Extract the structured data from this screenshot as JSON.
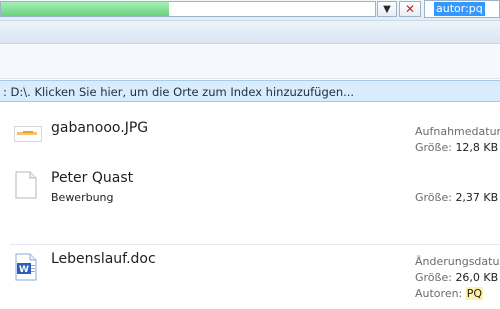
{
  "toolbar": {
    "progress_fraction": 0.45,
    "search_selected_text": "autor:pq"
  },
  "infobar": {
    "text": ": D:\\. Klicken Sie hier, um die Orte zum Index hinzuzufügen..."
  },
  "items": [
    {
      "name": "gabanooo.JPG",
      "meta1_label": "Aufnahmedatum",
      "meta2_label": "Größe:",
      "meta2_value": "12,8 KB"
    },
    {
      "name": "Peter Quast",
      "subtitle": "Bewerbung",
      "meta2_label": "Größe:",
      "meta2_value": "2,37 KB"
    },
    {
      "name": "Lebenslauf.doc",
      "meta1_label": "Änderungsdatum",
      "meta2_label": "Größe:",
      "meta2_value": "26,0 KB",
      "meta3_label": "Autoren:",
      "meta3_value": "PQ"
    }
  ],
  "colors": {
    "selection": "#3399ff",
    "highlight": "#fff2a8",
    "infobar": "#d8ecfb",
    "progress": "#6ad27d",
    "close": "#c0282c"
  }
}
